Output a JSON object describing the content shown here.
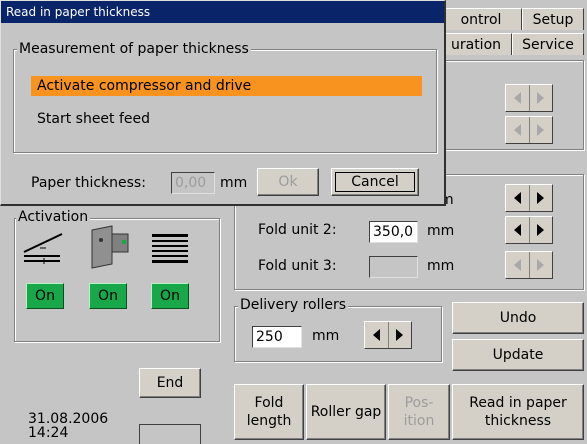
{
  "tabs": {
    "control": "ontrol",
    "setup": "Setup",
    "configuration": "uration",
    "service": "Service"
  },
  "activation": {
    "legend": "Activation",
    "on_buttons": [
      "On",
      "On",
      "On"
    ]
  },
  "fold": {
    "unit1_unit": "m",
    "unit2_label": "Fold unit 2:",
    "unit2_value": "350,0",
    "unit2_unit": "mm",
    "unit3_label": "Fold unit 3:",
    "unit3_value": "",
    "unit3_unit": "mm"
  },
  "delivery": {
    "legend": "Delivery rollers",
    "value": "250",
    "unit": "mm"
  },
  "buttons": {
    "undo": "Undo",
    "update": "Update",
    "end": "End"
  },
  "datetime": {
    "date": "31.08.2006",
    "time": "14:24"
  },
  "bottom_tabs": {
    "fold_length": "Fold\nlength",
    "roller_gap": "Roller gap",
    "position": "Pos-\nition",
    "read_thickness": "Read in paper\nthickness"
  },
  "dialog": {
    "title": "Read in paper thickness",
    "group_legend": "Measurement of paper thickness",
    "option_activate": "Activate compressor and drive",
    "option_sheet_feed": "Start sheet feed",
    "thickness_label": "Paper thickness:",
    "thickness_value": "0,00",
    "thickness_unit": "mm",
    "ok": "Ok",
    "cancel": "Cancel"
  },
  "colors": {
    "highlight": "#f7931e",
    "on_green": "#18a84a",
    "title_blue": "#0a246a"
  }
}
